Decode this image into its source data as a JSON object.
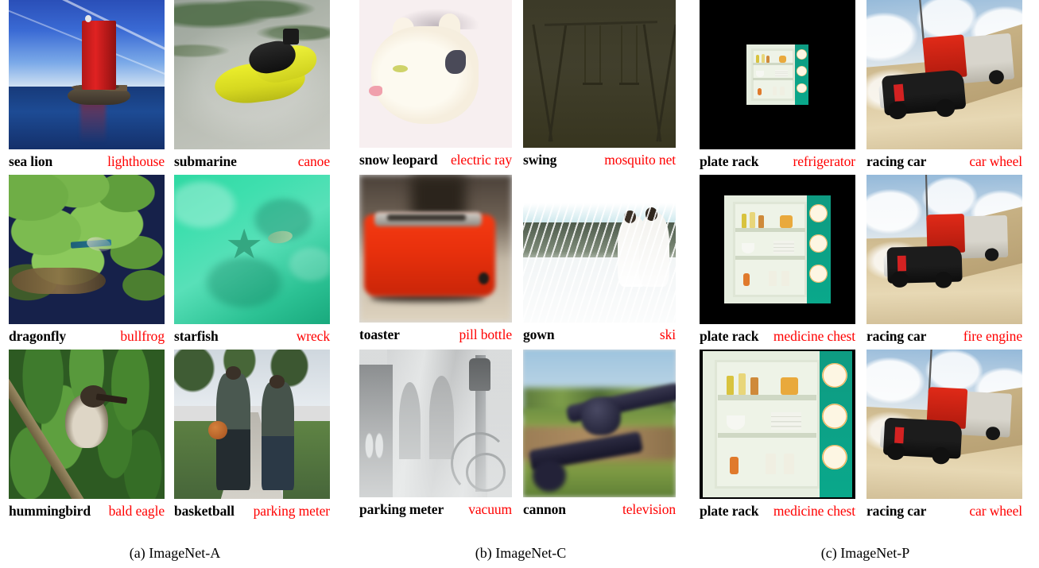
{
  "figure": {
    "type": "dataset-examples-figure",
    "colors": {
      "ground_truth": "#000000",
      "prediction": "#ff0000",
      "background": "#ffffff"
    },
    "legend_note": "black bold = ground-truth label, red = model prediction"
  },
  "panels": [
    {
      "id": "panel-a",
      "caption": "(a) ImageNet-A",
      "cells": [
        {
          "name": "sea-lion-buoy",
          "gt": "sea lion",
          "pred": "lighthouse"
        },
        {
          "name": "yellow-submarine",
          "gt": "submarine",
          "pred": "canoe"
        },
        {
          "name": "dragonfly-lilypads",
          "gt": "dragonfly",
          "pred": "bullfrog"
        },
        {
          "name": "starfish-underwater",
          "gt": "starfish",
          "pred": "wreck"
        },
        {
          "name": "hummingbird-leaves",
          "gt": "hummingbird",
          "pred": "bald eagle"
        },
        {
          "name": "basketball-sidewalk",
          "gt": "basketball",
          "pred": "parking meter"
        }
      ]
    },
    {
      "id": "panel-b",
      "caption": "(b) ImageNet-C",
      "cells": [
        {
          "name": "snow-leopard-contrast",
          "gt": "snow leopard",
          "pred": "electric ray"
        },
        {
          "name": "swing-brightness",
          "gt": "swing",
          "pred": "mosquito net"
        },
        {
          "name": "toaster-blur",
          "gt": "toaster",
          "pred": "pill bottle"
        },
        {
          "name": "gown-snow",
          "gt": "gown",
          "pred": "ski"
        },
        {
          "name": "parking-meter-fog",
          "gt": "parking meter",
          "pred": "vacuum"
        },
        {
          "name": "cannon-motion-blur",
          "gt": "cannon",
          "pred": "television"
        }
      ]
    },
    {
      "id": "panel-c",
      "caption": "(c) ImageNet-P",
      "cells": [
        {
          "name": "plate-rack-zoom-1",
          "gt": "plate rack",
          "pred": "refrigerator"
        },
        {
          "name": "racing-car-tilt-1",
          "gt": "racing car",
          "pred": "car wheel"
        },
        {
          "name": "plate-rack-zoom-2",
          "gt": "plate rack",
          "pred": "medicine chest"
        },
        {
          "name": "racing-car-tilt-2",
          "gt": "racing car",
          "pred": "fire engine"
        },
        {
          "name": "plate-rack-zoom-3",
          "gt": "plate rack",
          "pred": "medicine chest"
        },
        {
          "name": "racing-car-tilt-3",
          "gt": "racing car",
          "pred": "car wheel"
        }
      ]
    }
  ]
}
